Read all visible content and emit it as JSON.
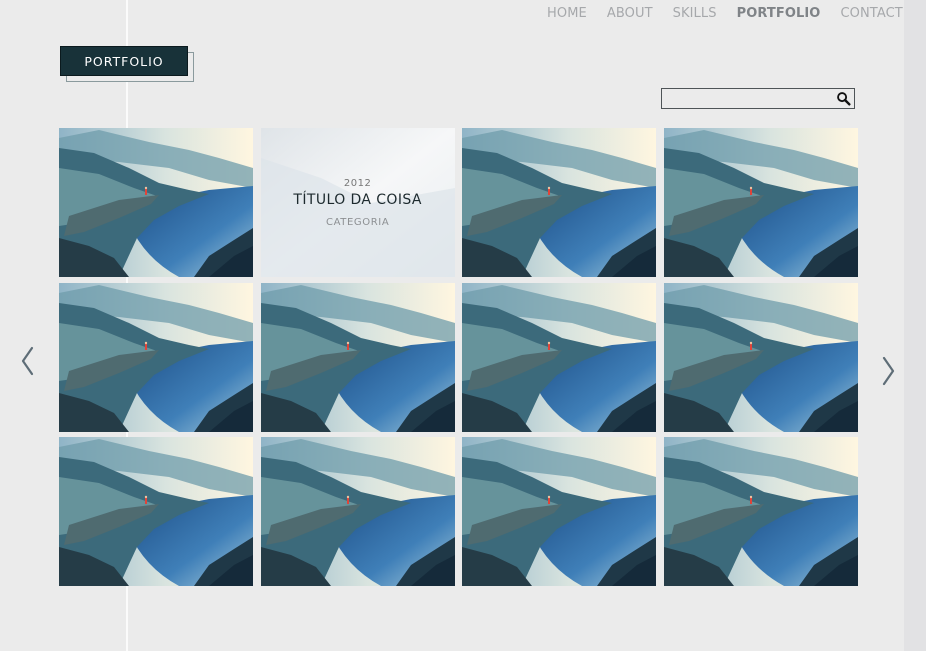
{
  "nav": {
    "items": [
      {
        "label": "HOME",
        "active": false
      },
      {
        "label": "ABOUT",
        "active": false
      },
      {
        "label": "SKILLS",
        "active": false
      },
      {
        "label": "PORTFOLIO",
        "active": true
      },
      {
        "label": "CONTACT",
        "active": false
      }
    ]
  },
  "logo": {
    "label": "PORTFOLIO"
  },
  "search": {
    "value": "",
    "placeholder": "",
    "icon": "search-icon"
  },
  "portfolio": {
    "tiles_count": 12,
    "hovered_tile_index": 1,
    "hover": {
      "year": "2012",
      "title": "TÍTULO DA COISA",
      "category": "CATEGORIA"
    }
  },
  "pagination": {
    "prev_icon": "chevron-left-icon",
    "next_icon": "chevron-right-icon"
  },
  "colors": {
    "background": "#ebebeb",
    "logo_bg": "#183239",
    "nav_text": "#a6a8ab",
    "nav_active": "#7f8387",
    "search_border": "#4e5457"
  }
}
